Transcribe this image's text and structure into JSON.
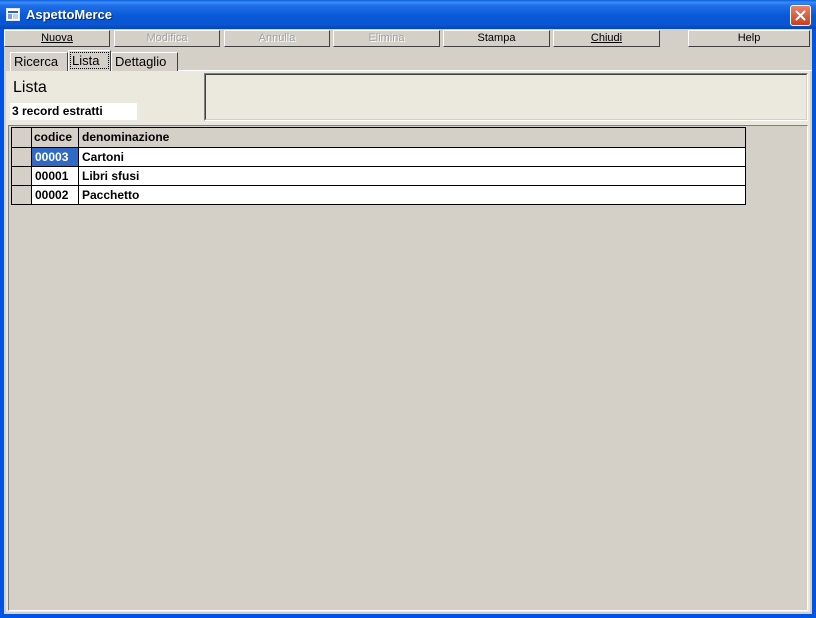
{
  "window": {
    "title": "AspettoMerce",
    "icon": "app-window-icon",
    "colors": {
      "titlebar": "#0a55d0",
      "close": "#c8401e",
      "selection": "#316ac5"
    }
  },
  "toolbar": {
    "buttons": [
      {
        "label": "Nuova",
        "enabled": true
      },
      {
        "label": "Modifica",
        "enabled": false
      },
      {
        "label": "Annulla",
        "enabled": false
      },
      {
        "label": "Elimina",
        "enabled": false
      },
      {
        "label": "Stampa",
        "enabled": true
      },
      {
        "label": "Chiudi",
        "enabled": true
      },
      {
        "label": "Help",
        "enabled": true
      }
    ]
  },
  "tabs": [
    {
      "label": "Ricerca",
      "active": false
    },
    {
      "label": "Lista",
      "active": true
    },
    {
      "label": "Dettaglio",
      "active": false
    }
  ],
  "list": {
    "title": "Lista",
    "record_count": "3 record estratti",
    "columns": [
      "codice",
      "denominazione"
    ],
    "rows": [
      {
        "codice": "00003",
        "denominazione": "Cartoni",
        "selected": true
      },
      {
        "codice": "00001",
        "denominazione": "Libri sfusi",
        "selected": false
      },
      {
        "codice": "00002",
        "denominazione": "Pacchetto",
        "selected": false
      }
    ]
  }
}
